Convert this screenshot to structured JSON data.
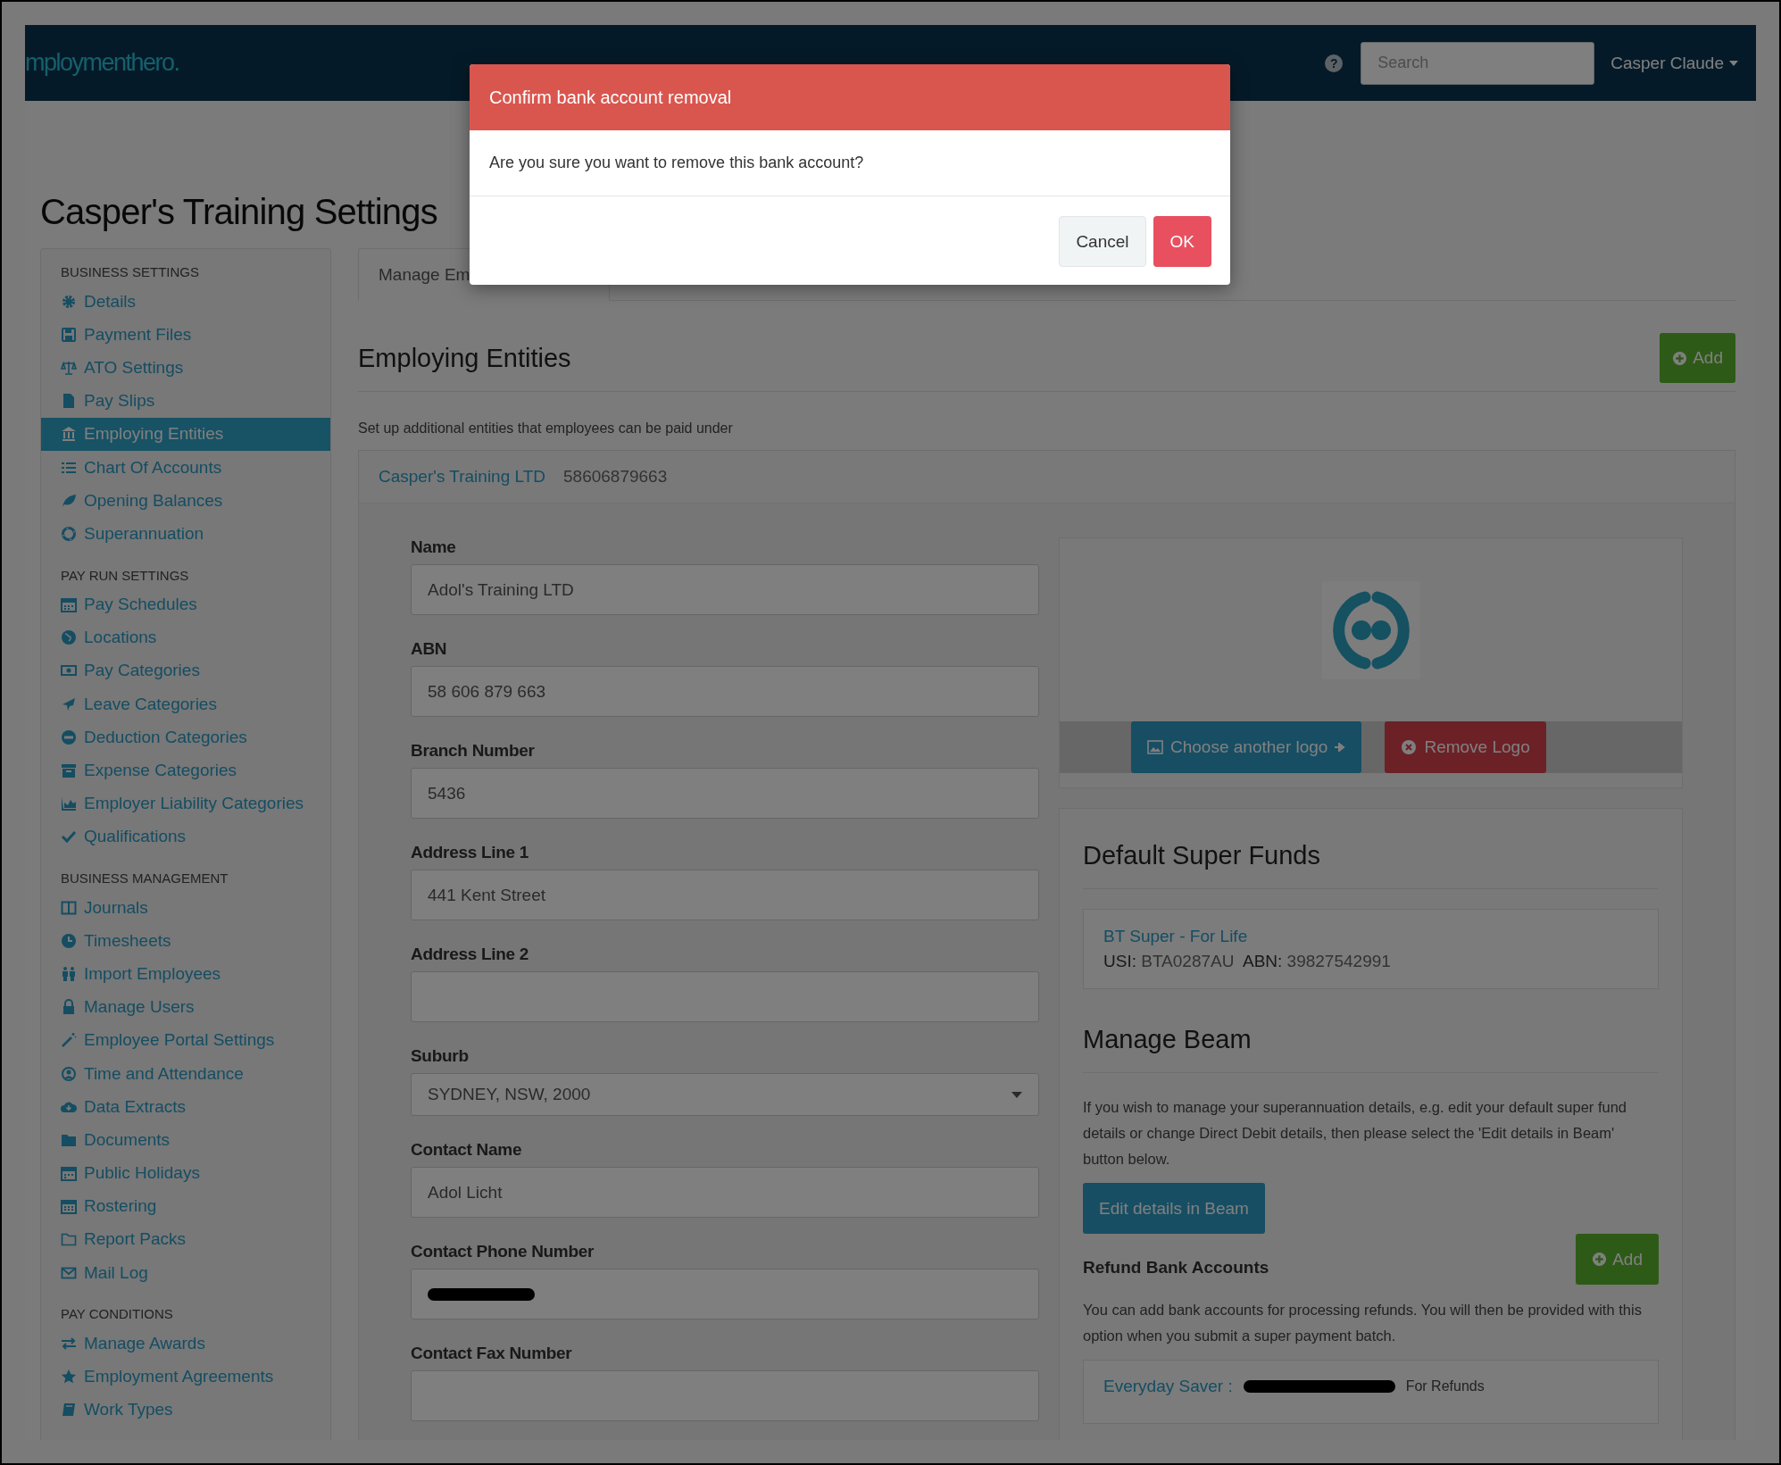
{
  "navbar": {
    "logo": "mploymenthero.",
    "help": "?",
    "search": {
      "placeholder": "Search"
    },
    "user": "Casper Claude"
  },
  "page_title": "Casper's Training Settings",
  "sidebar": {
    "sections": [
      {
        "heading": "BUSINESS SETTINGS",
        "items": [
          {
            "label": "Details",
            "selected": false
          },
          {
            "label": "Payment Files",
            "selected": false
          },
          {
            "label": "ATO Settings",
            "selected": false
          },
          {
            "label": "Pay Slips",
            "selected": false
          },
          {
            "label": "Employing Entities",
            "selected": true
          },
          {
            "label": "Chart Of Accounts",
            "selected": false
          },
          {
            "label": "Opening Balances",
            "selected": false
          },
          {
            "label": "Superannuation",
            "selected": false
          }
        ]
      },
      {
        "heading": "PAY RUN SETTINGS",
        "items": [
          {
            "label": "Pay Schedules",
            "selected": false
          },
          {
            "label": "Locations",
            "selected": false
          },
          {
            "label": "Pay Categories",
            "selected": false
          },
          {
            "label": "Leave Categories",
            "selected": false
          },
          {
            "label": "Deduction Categories",
            "selected": false
          },
          {
            "label": "Expense Categories",
            "selected": false
          },
          {
            "label": "Employer Liability Categories",
            "selected": false
          },
          {
            "label": "Qualifications",
            "selected": false
          }
        ]
      },
      {
        "heading": "BUSINESS MANAGEMENT",
        "items": [
          {
            "label": "Journals",
            "selected": false
          },
          {
            "label": "Timesheets",
            "selected": false
          },
          {
            "label": "Import Employees",
            "selected": false
          },
          {
            "label": "Manage Users",
            "selected": false
          },
          {
            "label": "Employee Portal Settings",
            "selected": false
          },
          {
            "label": "Time and Attendance",
            "selected": false
          },
          {
            "label": "Data Extracts",
            "selected": false
          },
          {
            "label": "Documents",
            "selected": false
          },
          {
            "label": "Public Holidays",
            "selected": false
          },
          {
            "label": "Rostering",
            "selected": false
          },
          {
            "label": "Report Packs",
            "selected": false
          },
          {
            "label": "Mail Log",
            "selected": false
          }
        ]
      },
      {
        "heading": "PAY CONDITIONS",
        "items": [
          {
            "label": "Manage Awards",
            "selected": false
          },
          {
            "label": "Employment Agreements",
            "selected": false
          },
          {
            "label": "Work Types",
            "selected": false
          }
        ]
      }
    ]
  },
  "tabs": [
    {
      "label": "Manage Em",
      "selected": true
    }
  ],
  "section": {
    "title": "Employing Entities",
    "add_button": "Add",
    "description": "Set up additional entities that employees can be paid under"
  },
  "entity": {
    "name": "Casper's Training LTD",
    "number": "58606879663",
    "fields": [
      {
        "kind": "text",
        "label": "Name",
        "value": "Adol's Training LTD"
      },
      {
        "kind": "text",
        "label": "ABN",
        "value": "58 606 879 663"
      },
      {
        "kind": "text",
        "label": "Branch Number",
        "value": "5436"
      },
      {
        "kind": "text",
        "label": "Address Line 1",
        "value": "441 Kent Street"
      },
      {
        "kind": "text",
        "label": "Address Line 2"
      },
      {
        "kind": "select",
        "label": "Suburb",
        "value": "SYDNEY, NSW, 2000"
      },
      {
        "kind": "text",
        "label": "Contact Name",
        "value": "Adol Licht"
      },
      {
        "kind": "redacted",
        "label": "Contact Phone Number"
      },
      {
        "kind": "text",
        "label": "Contact Fax Number"
      }
    ],
    "logo_buttons": {
      "choose": "Choose another logo",
      "remove": "Remove Logo"
    }
  },
  "super_funds": {
    "title": "Default Super Funds",
    "fund": {
      "name": "BT Super - For Life",
      "usi_label": "USI:",
      "usi": "BTA0287AU",
      "abn_label": "ABN:",
      "abn": "39827542991"
    }
  },
  "beam": {
    "title": "Manage Beam",
    "text": "If you wish to manage your superannuation details, e.g. edit your default super fund details or change Direct Debit details, then please select the 'Edit details in Beam' button below.",
    "button": "Edit details in Beam",
    "refund_title": "Refund Bank Accounts",
    "add_button": "Add",
    "refund_text": "You can add bank accounts for processing refunds. You will then be provided with this option when you submit a super payment batch.",
    "accounts": [
      {
        "name": "Everyday Saver :",
        "note": "For Refunds"
      }
    ]
  },
  "modal": {
    "title": "Confirm bank account removal",
    "message": "Are you sure you want to remove this bank account?",
    "buttons": [
      {
        "kind": "secondary",
        "label": "Cancel"
      },
      {
        "kind": "danger",
        "label": "OK"
      }
    ]
  }
}
